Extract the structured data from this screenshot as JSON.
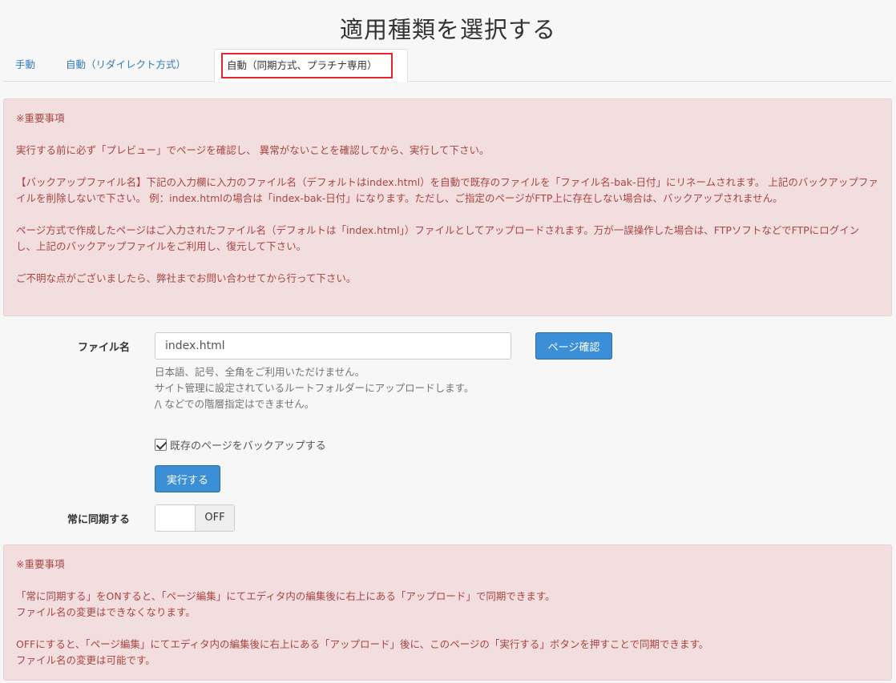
{
  "page": {
    "title": "適用種類を選択する"
  },
  "tabs": [
    {
      "label": "手動"
    },
    {
      "label": "自動（リダイレクト方式）"
    },
    {
      "label": "自動（同期方式、プラチナ専用）"
    }
  ],
  "notice_top": {
    "heading": "※重要事項",
    "paragraphs": [
      "実行する前に必ず「プレビュー」でページを確認し、 異常がないことを確認してから、実行して下さい。",
      "【バックアップファイル名】下記の入力欄に入力のファイル名（デフォルトはindex.html）を自動で既存のファイルを「ファイル名-bak-日付」にリネームされます。 上記のバックアップファイルを削除しないで下さい。 例：index.htmlの場合は「index-bak-日付」になります。ただし、ご指定のページがFTP上に存在しない場合は、バックアップされません。",
      "ページ方式で作成したページはご入力されたファイル名（デフォルトは「index.html」）ファイルとしてアップロードされます。万が一誤操作した場合は、FTPソフトなどでFTPにログインし、上記のバックアップファイルをご利用し、復元して下さい。",
      "ご不明な点がございましたら、弊社までお問い合わせてから行って下さい。"
    ]
  },
  "form": {
    "file_label": "ファイル名",
    "file_value": "index.html",
    "preview_label": "ページ確認",
    "help_lines": [
      "日本語、記号、全角をご利用いただけません。",
      "サイト管理に設定されているルートフォルダーにアップロードします。",
      "/\\ などでの階層指定はできません。"
    ],
    "backup_label": "既存のページをバックアップする",
    "execute_label": "実行する",
    "sync_label": "常に同期する",
    "sync_state": "OFF"
  },
  "notice_bottom": {
    "heading": "※重要事項",
    "paragraphs": [
      [
        "「常に同期する」をONすると、「ページ編集」にてエディタ内の編集後に右上にある「アップロード」で同期できます。",
        "ファイル名の変更はできなくなります。"
      ],
      [
        "OFFにすると、「ページ編集」にてエディタ内の編集後に右上にある「アップロード」後に、このページの「実行する」ボタンを押すことで同期できます。",
        "ファイル名の変更は可能です。"
      ]
    ]
  }
}
